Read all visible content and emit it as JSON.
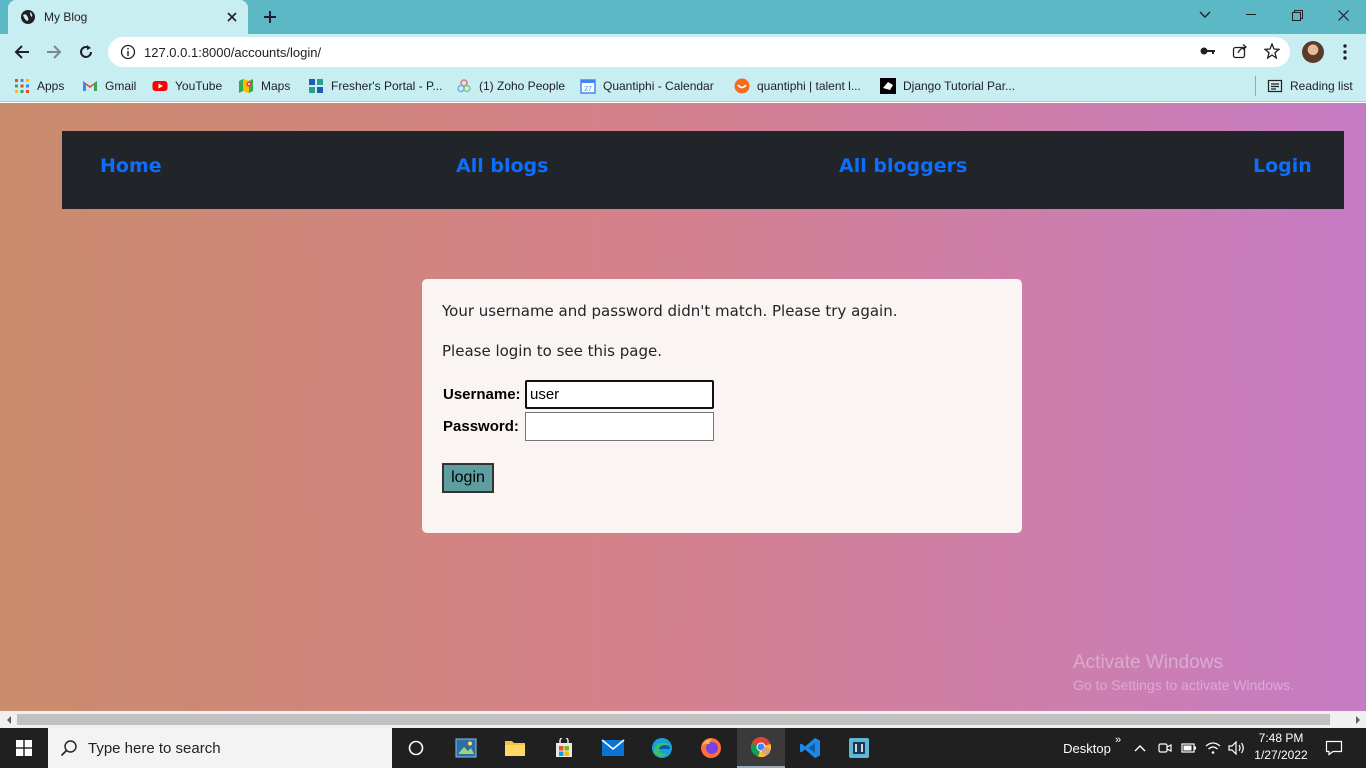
{
  "browser": {
    "tab_title": "My Blog",
    "url": "127.0.0.1:8000/accounts/login/",
    "bookmarks": [
      {
        "label": "Apps",
        "icon": "apps-grid-icon"
      },
      {
        "label": "Gmail",
        "icon": "gmail-icon"
      },
      {
        "label": "YouTube",
        "icon": "youtube-icon"
      },
      {
        "label": "Maps",
        "icon": "maps-icon"
      },
      {
        "label": "Fresher's Portal - P...",
        "icon": "portal-icon"
      },
      {
        "label": "(1) Zoho People",
        "icon": "zoho-icon"
      },
      {
        "label": "Quantiphi - Calendar",
        "icon": "calendar-icon"
      },
      {
        "label": "quantiphi | talent l...",
        "icon": "talent-icon"
      },
      {
        "label": "Django Tutorial Par...",
        "icon": "mdn-icon"
      }
    ],
    "reading_list": "Reading list"
  },
  "site": {
    "nav": {
      "home": "Home",
      "all_blogs": "All blogs",
      "all_bloggers": "All bloggers",
      "login": "Login"
    },
    "error_message": "Your username and password didn't match. Please try again.",
    "info_message": "Please login to see this page.",
    "form": {
      "username_label": "Username:",
      "username_value": "user",
      "password_label": "Password:",
      "password_value": "",
      "submit_label": "login"
    }
  },
  "watermark": {
    "line1": "Activate Windows",
    "line2": "Go to Settings to activate Windows."
  },
  "taskbar": {
    "search_placeholder": "Type here to search",
    "desktop_label": "Desktop",
    "time": "7:48 PM",
    "date": "1/27/2022"
  },
  "colors": {
    "nav_bg": "#212529",
    "nav_link": "#0d6efd",
    "button_bg": "#5f9ea0",
    "tab_strip": "#5bb8c4",
    "toolbar": "#c8eef2"
  }
}
